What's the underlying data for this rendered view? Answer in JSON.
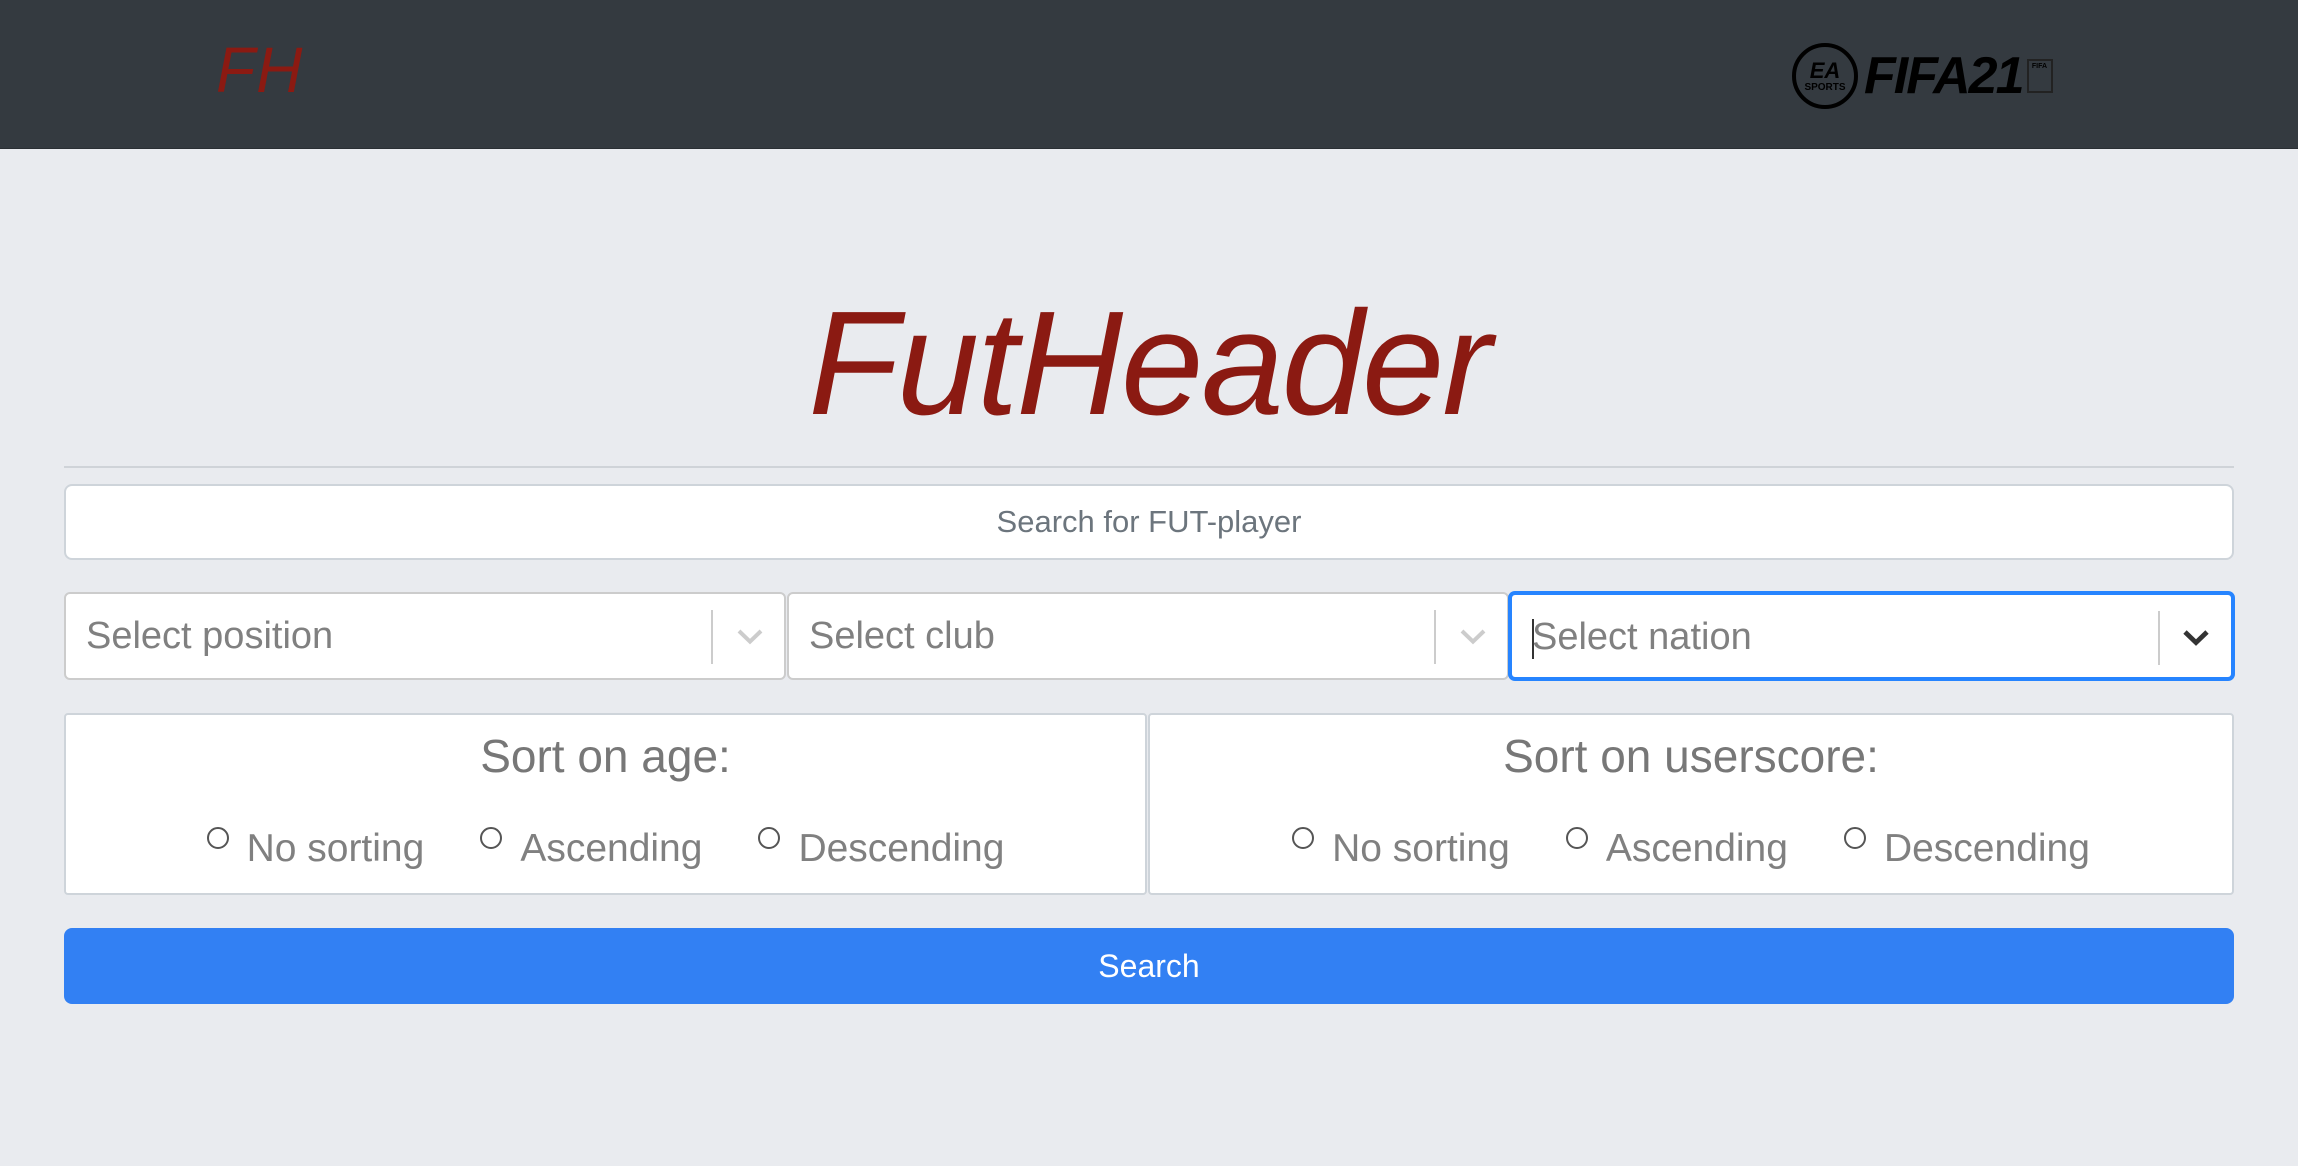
{
  "navbar": {
    "brand": "FH",
    "logo": {
      "ea_text": "EA",
      "sports_text": "SPORTS",
      "fifa_text": "FIFA21",
      "mini_badge_text": "FIFA"
    }
  },
  "hero": {
    "title": "FutHeader"
  },
  "search": {
    "placeholder": "Search for FUT-player",
    "value": ""
  },
  "filters": [
    {
      "placeholder": "Select position",
      "focused": false
    },
    {
      "placeholder": "Select club",
      "focused": false
    },
    {
      "placeholder": "Select nation",
      "focused": true
    }
  ],
  "sort_age": {
    "title": "Sort on age:",
    "options": [
      "No sorting",
      "Ascending",
      "Descending"
    ]
  },
  "sort_userscore": {
    "title": "Sort on userscore:",
    "options": [
      "No sorting",
      "Ascending",
      "Descending"
    ]
  },
  "search_button": {
    "label": "Search"
  },
  "colors": {
    "navbar_bg": "#343a40",
    "brand_red": "#8b1a12",
    "page_bg": "#e9ebef",
    "primary_blue": "#3280f3",
    "focus_blue": "#2684ff"
  },
  "icons": {
    "select_indicator": "chevron-down-icon",
    "radio": "radio-unchecked"
  }
}
